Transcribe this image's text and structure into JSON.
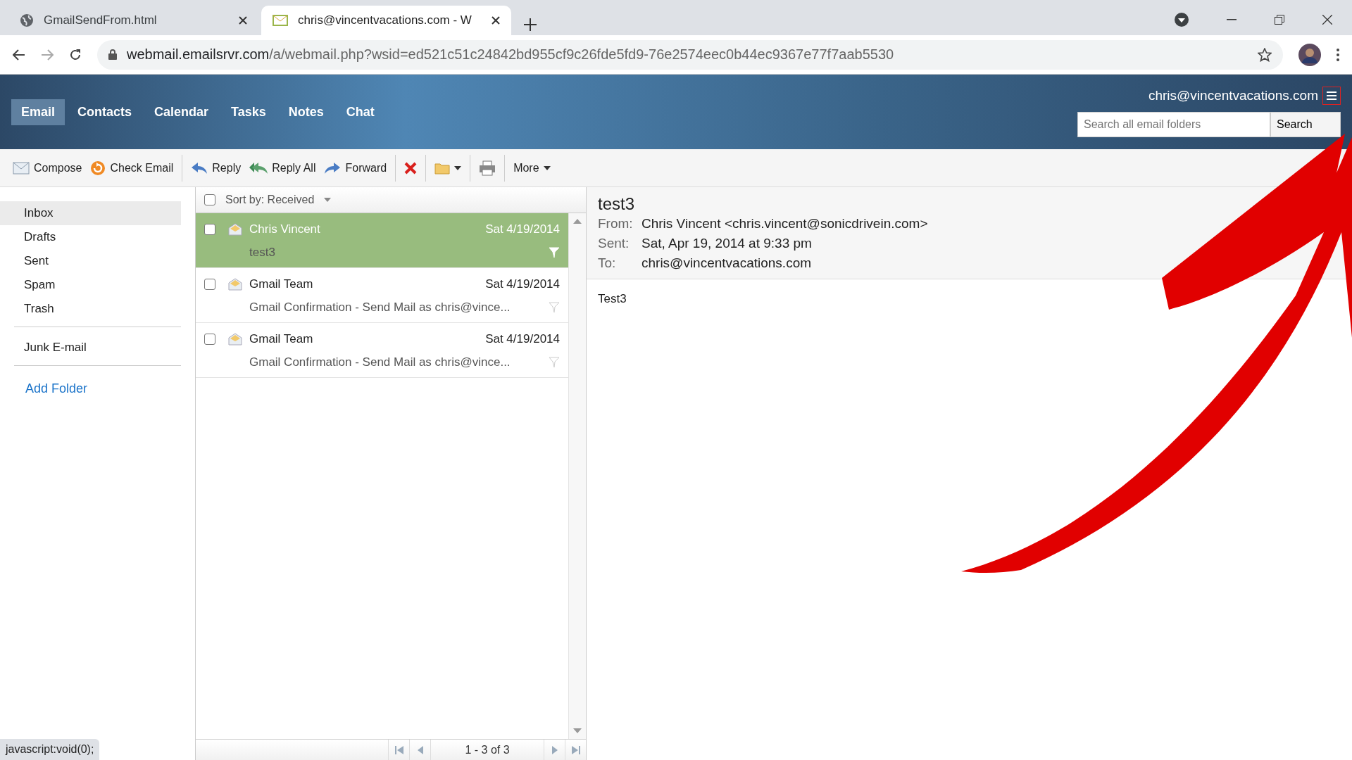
{
  "browser": {
    "tabs": [
      {
        "title": "GmailSendFrom.html",
        "kind": "page",
        "selected": false
      },
      {
        "title": "chris@vincentvacations.com - W",
        "kind": "mail",
        "selected": true
      }
    ],
    "address": {
      "host": "webmail.emailsrvr.com",
      "path": "/a/webmail.php?wsid=ed521c51c24842bd955cf9c26fde5fd9-76e2574eec0b44ec9367e77f7aab5530"
    },
    "status_text": "javascript:void(0);"
  },
  "header": {
    "user_email": "chris@vincentvacations.com",
    "nav": [
      {
        "label": "Email",
        "selected": true
      },
      {
        "label": "Contacts",
        "selected": false
      },
      {
        "label": "Calendar",
        "selected": false
      },
      {
        "label": "Tasks",
        "selected": false
      },
      {
        "label": "Notes",
        "selected": false
      },
      {
        "label": "Chat",
        "selected": false
      }
    ],
    "search": {
      "placeholder": "Search all email folders",
      "button": "Search"
    }
  },
  "toolbar": [
    [
      {
        "kind": "compose",
        "label": "Compose"
      },
      {
        "kind": "refresh",
        "label": "Check Email"
      }
    ],
    [
      {
        "kind": "reply",
        "label": "Reply"
      },
      {
        "kind": "reply-all",
        "label": "Reply All"
      },
      {
        "kind": "forward",
        "label": "Forward"
      }
    ],
    [
      {
        "kind": "delete"
      }
    ],
    [
      {
        "kind": "move"
      }
    ],
    [
      {
        "kind": "print"
      }
    ],
    [
      {
        "kind": "more",
        "label": "More"
      }
    ]
  ],
  "folders": [
    [
      {
        "label": "Inbox",
        "selected": true
      },
      {
        "label": "Drafts",
        "selected": false
      },
      {
        "label": "Sent",
        "selected": false
      },
      {
        "label": "Spam",
        "selected": false
      },
      {
        "label": "Trash",
        "selected": false
      }
    ],
    [
      {
        "label": "Junk E-mail",
        "selected": false
      }
    ]
  ],
  "add_folder": "Add Folder",
  "message_list": {
    "sort_label": "Sort by: Received",
    "all_checked": false,
    "messages": [
      {
        "sender": "Chris Vincent",
        "date": "Sat 4/19/2014",
        "subject": "test3",
        "selected": true,
        "checked": false
      },
      {
        "sender": "Gmail Team",
        "date": "Sat 4/19/2014",
        "subject": "Gmail Confirmation - Send Mail as chris@vince...",
        "selected": false,
        "checked": false
      },
      {
        "sender": "Gmail Team",
        "date": "Sat 4/19/2014",
        "subject": "Gmail Confirmation - Send Mail as chris@vince...",
        "selected": false,
        "checked": false
      }
    ],
    "pager": "1 - 3 of 3"
  },
  "preview": {
    "subject": "test3",
    "fields": [
      {
        "label": "From:",
        "value": "Chris Vincent <chris.vincent@sonicdrivein.com>"
      },
      {
        "label": "Sent:",
        "value": "Sat, Apr 19, 2014 at 9:33 pm"
      },
      {
        "label": "To:",
        "value": "chris@vincentvacations.com"
      }
    ],
    "body": "Test3"
  }
}
